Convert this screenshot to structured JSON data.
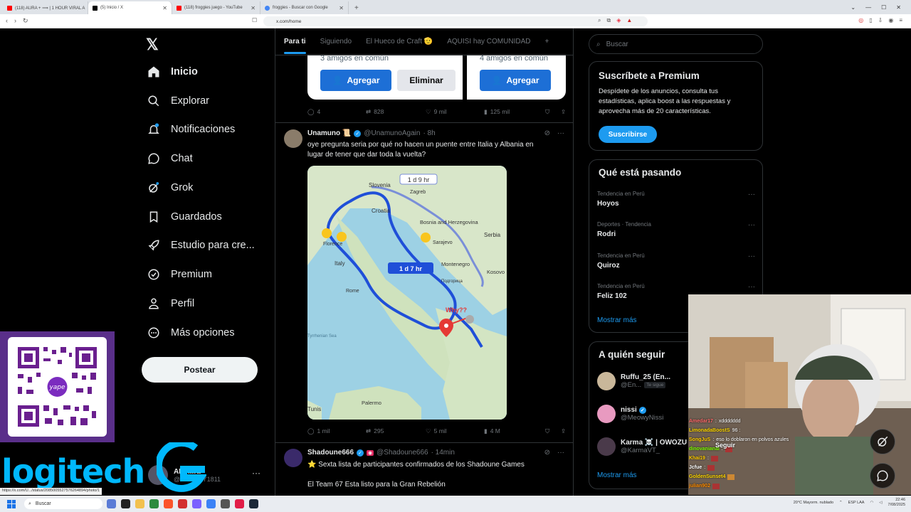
{
  "browser": {
    "tabs": [
      {
        "label": "(118) AURA + ⟹ | 1 HOUR VIRAL A",
        "active": false,
        "color": "#ff0000"
      },
      {
        "label": "(5) Inicio / X",
        "active": true,
        "color": "#000000"
      },
      {
        "label": "(118) froggies juego - YouTube",
        "active": false,
        "color": "#ff0000"
      },
      {
        "label": "froggies - Buscar con Google",
        "active": false,
        "color": "#4285f4"
      }
    ],
    "new_tab": "+",
    "url": "x.com/home"
  },
  "nav": {
    "logo": "𝕏",
    "items": [
      {
        "label": "Inicio",
        "icon": "home-icon",
        "active": true
      },
      {
        "label": "Explorar",
        "icon": "search-icon"
      },
      {
        "label": "Notificaciones",
        "icon": "bell-icon"
      },
      {
        "label": "Chat",
        "icon": "chat-icon"
      },
      {
        "label": "Grok",
        "icon": "grok-icon"
      },
      {
        "label": "Guardados",
        "icon": "bookmark-icon"
      },
      {
        "label": "Estudio para cre...",
        "icon": "rocket-icon"
      },
      {
        "label": "Premium",
        "icon": "premium-icon"
      },
      {
        "label": "Perfil",
        "icon": "person-icon"
      },
      {
        "label": "Más opciones",
        "icon": "more-circle-icon"
      }
    ],
    "post_button": "Postear",
    "account": {
      "name": "AN7...ra",
      "handle": "@AN7...NY1811"
    }
  },
  "overlay": {
    "qr_label": "yape",
    "logitech": "logitech"
  },
  "feed": {
    "tabs": [
      "Para ti",
      "Siguiendo",
      "El Hueco de Craft 🫡",
      "AQUISI hay COMUNIDAD"
    ],
    "tab_more": "+",
    "suggest": [
      {
        "common": "3 amigos en común",
        "add": "Agregar",
        "remove": "Eliminar"
      },
      {
        "common": "4 amigos en común",
        "add": "Agregar"
      }
    ],
    "post0_stats": {
      "replies": "4",
      "reposts": "828",
      "likes": "9 mil",
      "views": "125 mil"
    },
    "post1": {
      "name": "Unamuno 📜",
      "handle": "@UnamunoAgain",
      "time": "· 8h",
      "text": "oye pregunta seria por qué no hacen un puente entre Italia y Albania en lugar de tener que dar toda la vuelta?",
      "map_labels": {
        "route_top": "1 d 9 hr",
        "route_main": "1 d 7 hr",
        "why": "Why??",
        "slovenia": "Slovenia",
        "zagreb": "Zagreb",
        "croatia": "Croatia",
        "bosnia": "Bosnia and Herzegovina",
        "sarajevo": "Sarajevo",
        "serbia": "Serbia",
        "florence": "Florence",
        "italy": "Italy",
        "rome": "Rome",
        "montenegro": "Montenegro",
        "podgorica": "Подгорица",
        "kosovo": "Kosovo",
        "tyrrhenian": "Tyrrhenian Sea",
        "palermo": "Palermo",
        "tunis": "Tunis"
      },
      "stats": {
        "replies": "1 mil",
        "reposts": "295",
        "likes": "5 mil",
        "views": "4 M"
      }
    },
    "post2": {
      "name": "Shadoune666",
      "handle": "@Shadoune666",
      "time": "· 14min",
      "line1": "⭐ Sexta lista de participantes confirmados de los Shadoune Games",
      "line2": "El Team 67 Esta listo para la Gran Rebelión"
    }
  },
  "right": {
    "search_placeholder": "Buscar",
    "premium": {
      "title": "Suscríbete a Premium",
      "text": "Despídete de los anuncios, consulta tus estadísticas, aplica boost a las respuestas y aprovecha más de 20 características.",
      "button": "Suscribirse"
    },
    "trends": {
      "title": "Qué está pasando",
      "items": [
        {
          "context": "Tendencia en Perú",
          "name": "Hoyos"
        },
        {
          "context": "Deportes · Tendencia",
          "name": "Rodri"
        },
        {
          "context": "Tendencia en Perú",
          "name": "Quiroz"
        },
        {
          "context": "Tendencia en Perú",
          "name": "Feliz 102"
        }
      ],
      "show_more": "Mostrar más"
    },
    "who_to_follow": {
      "title": "A quién seguir",
      "items": [
        {
          "name": "Ruffu_25 (En...",
          "handle": "@En...",
          "badge": "Te sigue"
        },
        {
          "name": "nissi",
          "handle": "@MeowyNissi"
        },
        {
          "name": "Karma ☠️ | OWOZU",
          "handle": "@KarmaVT_"
        }
      ],
      "show_more": "Mostrar más"
    }
  },
  "stream_chat": {
    "seguir": "Seguir",
    "lines": [
      {
        "user": "Amedar17",
        "msg": "xddddddd",
        "color": "#ff6b6b"
      },
      {
        "user": "LimonadaBoostS",
        "msg": "96 :",
        "color": "#ffd700"
      },
      {
        "user": "SongJuS",
        "msg": "eso lo doblaron en polvos azules",
        "color": "#ffcc00"
      },
      {
        "user": "dinovanianal",
        "msg": "",
        "color": "#7fff00"
      },
      {
        "user": "Khai19",
        "msg": "",
        "color": "#ffcc00"
      },
      {
        "user": "Jcfue",
        "msg": "",
        "color": "#ffffff"
      },
      {
        "user": "GoldenSunset4",
        "msg": "",
        "color": "#ffd700"
      },
      {
        "user": "julian902",
        "msg": "",
        "color": "#ff8c00"
      }
    ]
  },
  "taskbar": {
    "search": "Buscar",
    "weather": "20°C Mayorm. nublado",
    "lang": "ESP LAA",
    "time": "22:46",
    "date": "7/08/2025"
  },
  "status_url": "https://x.com/U.../status/20850055275762648​94/photo/1",
  "colors": {
    "accent": "#1d9bf0",
    "bg": "#000000",
    "border": "#2f3336"
  }
}
